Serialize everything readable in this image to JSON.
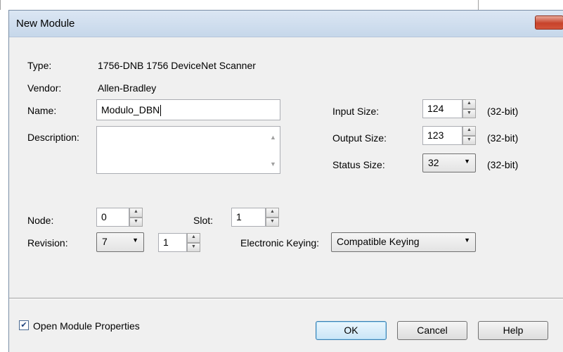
{
  "window": {
    "title": "New Module",
    "close_glyph": "✕"
  },
  "module": {
    "type_label": "Type:",
    "type_value": "1756-DNB 1756 DeviceNet Scanner",
    "vendor_label": "Vendor:",
    "vendor_value": "Allen-Bradley",
    "name_label": "Name:",
    "name_value": "Modulo_DBN",
    "description_label": "Description:",
    "description_value": ""
  },
  "sizes": {
    "input_label": "Input Size:",
    "input_value": "124",
    "input_unit": "(32-bit)",
    "output_label": "Output Size:",
    "output_value": "123",
    "output_unit": "(32-bit)",
    "status_label": "Status Size:",
    "status_value": "32",
    "status_unit": "(32-bit)"
  },
  "config": {
    "node_label": "Node:",
    "node_value": "0",
    "slot_label": "Slot:",
    "slot_value": "1",
    "revision_label": "Revision:",
    "revision_major": "7",
    "revision_minor": "1",
    "keying_label": "Electronic Keying:",
    "keying_value": "Compatible Keying"
  },
  "footer": {
    "open_props_label": "Open Module Properties",
    "open_props_checked": true,
    "ok_label": "OK",
    "cancel_label": "Cancel",
    "help_label": "Help"
  },
  "icons": {
    "spin_up": "▲",
    "spin_down": "▼",
    "dropdown": "▼",
    "scroll_up": "▲",
    "scroll_down": "▼",
    "check": "✔"
  },
  "colors": {
    "title_bar": "#c6d7ea",
    "close_button": "#c7432b",
    "dialog_bg": "#f0f0f0",
    "default_button_border": "#3c7fb1"
  }
}
